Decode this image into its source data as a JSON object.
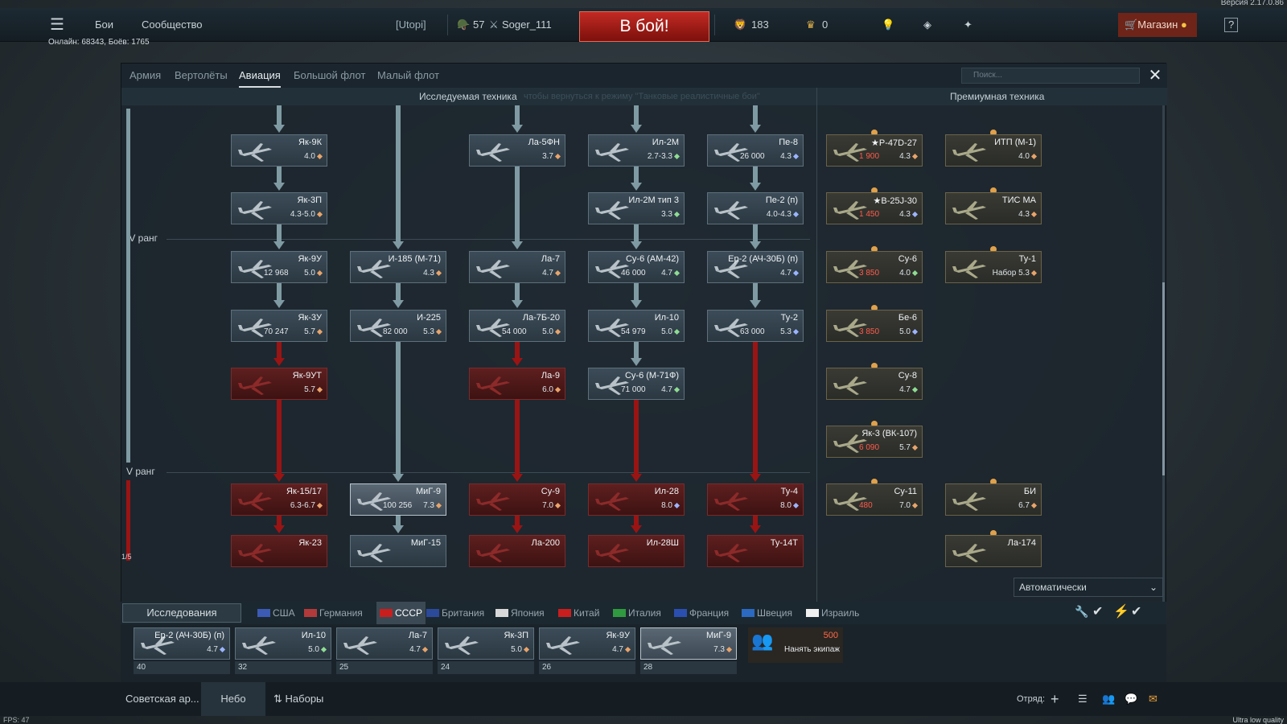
{
  "version": "Версия 2.17.0.86",
  "topbar": {
    "menu": "Бои",
    "community": "Сообщество",
    "squad_tag": "[Utopi]",
    "player_level": "57",
    "player_name": "Soger_111",
    "battle_button": "В бой!",
    "silver_lions": "183",
    "golden_eagles": "0",
    "shop": "Магазин",
    "help": "?"
  },
  "online": "Онлайн: 68343, Боёв: 1765",
  "tabs": [
    "Армия",
    "Вертолёты",
    "Авиация",
    "Большой флот",
    "Малый флот"
  ],
  "active_tab": "Авиация",
  "search_placeholder": "Поиск...",
  "headers": {
    "researched": "Исследуемая техника",
    "researched_hint": "чтобы вернуться к режиму \"Танковые реалистичные бои\"",
    "premium": "Премиумная техника"
  },
  "ranks": [
    "IV ранг",
    "V ранг"
  ],
  "page_indicator": "1/5",
  "tree": [
    {
      "id": "yak9k",
      "name": "Як-9К",
      "br": "4.0",
      "cost": "",
      "state": "researched",
      "dot": "orange"
    },
    {
      "id": "yak3p",
      "name": "Як-3П",
      "br": "4.3-5.0",
      "cost": "",
      "state": "researched",
      "dot": "orange"
    },
    {
      "id": "yak9u",
      "name": "Як-9У",
      "br": "5.0",
      "cost": "12 968",
      "state": "researched",
      "dot": "orange"
    },
    {
      "id": "yak3u",
      "name": "Як-3У",
      "br": "5.7",
      "cost": "70 247",
      "state": "researched",
      "dot": "orange"
    },
    {
      "id": "yak9ut",
      "name": "Як-9УТ",
      "br": "5.7",
      "cost": "",
      "state": "locked",
      "dot": "orange"
    },
    {
      "id": "yak1517",
      "name": "Як-15/17",
      "br": "6.3-6.7",
      "cost": "",
      "state": "locked",
      "dot": "orange"
    },
    {
      "id": "yak23",
      "name": "Як-23",
      "br": "",
      "cost": "",
      "state": "locked",
      "dot": ""
    },
    {
      "id": "i185",
      "name": "И-185 (М-71)",
      "br": "4.3",
      "cost": "",
      "state": "researched",
      "dot": "orange"
    },
    {
      "id": "i225",
      "name": "И-225",
      "br": "5.3",
      "cost": "82 000",
      "state": "researched",
      "dot": "orange"
    },
    {
      "id": "mig9",
      "name": "МиГ-9",
      "br": "7.3",
      "cost": "100 256",
      "state": "selected",
      "dot": "orange"
    },
    {
      "id": "mig15",
      "name": "МиГ-15",
      "br": "",
      "cost": "",
      "state": "researched",
      "dot": ""
    },
    {
      "id": "la5fn",
      "name": "Ла-5ФН",
      "br": "3.7",
      "cost": "",
      "state": "researched",
      "dot": "orange"
    },
    {
      "id": "la7",
      "name": "Ла-7",
      "br": "4.7",
      "cost": "",
      "state": "researched",
      "dot": "orange"
    },
    {
      "id": "la7b20",
      "name": "Ла-7Б-20",
      "br": "5.0",
      "cost": "54 000",
      "state": "researched",
      "dot": "orange"
    },
    {
      "id": "la9",
      "name": "Ла-9",
      "br": "6.0",
      "cost": "",
      "state": "locked",
      "dot": "orange"
    },
    {
      "id": "su9",
      "name": "Су-9",
      "br": "7.0",
      "cost": "",
      "state": "locked",
      "dot": "orange"
    },
    {
      "id": "la200",
      "name": "Ла-200",
      "br": "",
      "cost": "",
      "state": "locked",
      "dot": ""
    },
    {
      "id": "il2m",
      "name": "Ил-2М",
      "br": "2.7-3.3",
      "cost": "",
      "state": "researched",
      "dot": "green"
    },
    {
      "id": "il2m3",
      "name": "Ил-2М тип 3",
      "br": "3.3",
      "cost": "",
      "state": "researched",
      "dot": "green"
    },
    {
      "id": "su6am42",
      "name": "Су-6 (АМ-42)",
      "br": "4.7",
      "cost": "46 000",
      "state": "researched",
      "dot": "green"
    },
    {
      "id": "il10",
      "name": "Ил-10",
      "br": "5.0",
      "cost": "54 979",
      "state": "researched",
      "dot": "green"
    },
    {
      "id": "su6m71f",
      "name": "Су-6 (М-71Ф)",
      "br": "4.7",
      "cost": "71 000",
      "state": "researched",
      "dot": "green"
    },
    {
      "id": "il28",
      "name": "Ил-28",
      "br": "8.0",
      "cost": "",
      "state": "locked",
      "dot": "blue"
    },
    {
      "id": "il28sh",
      "name": "Ил-28Ш",
      "br": "",
      "cost": "",
      "state": "locked",
      "dot": ""
    },
    {
      "id": "pe8",
      "name": "Пе-8",
      "br": "4.3",
      "cost": "26 000",
      "state": "researched",
      "dot": "blue"
    },
    {
      "id": "pe2n",
      "name": "Пе-2 (п)",
      "br": "4.0-4.3",
      "cost": "",
      "state": "researched",
      "dot": "blue"
    },
    {
      "id": "er2",
      "name": "Ер-2 (АЧ-30Б) (п)",
      "br": "4.7",
      "cost": "",
      "state": "researched",
      "dot": "blue"
    },
    {
      "id": "tu2",
      "name": "Ту-2",
      "br": "5.3",
      "cost": "63 000",
      "state": "researched",
      "dot": "blue"
    },
    {
      "id": "tu4",
      "name": "Ту-4",
      "br": "8.0",
      "cost": "",
      "state": "locked",
      "dot": "blue"
    },
    {
      "id": "tu14t",
      "name": "Ту-14Т",
      "br": "",
      "cost": "",
      "state": "locked",
      "dot": ""
    }
  ],
  "premium": [
    {
      "id": "p47",
      "name": "★P-47D-27",
      "br": "4.3",
      "cost": "1 900",
      "dot": "orange"
    },
    {
      "id": "b25",
      "name": "★B-25J-30",
      "br": "4.3",
      "cost": "1 450",
      "dot": "blue"
    },
    {
      "id": "su6p",
      "name": "Су-6",
      "br": "4.0",
      "cost": "3 850",
      "dot": "green"
    },
    {
      "id": "be6",
      "name": "Бе-6",
      "br": "5.0",
      "cost": "3 850",
      "dot": "blue"
    },
    {
      "id": "su8",
      "name": "Су-8",
      "br": "4.7",
      "cost": "",
      "dot": "green"
    },
    {
      "id": "yak3vk",
      "name": "Як-3 (ВК-107)",
      "br": "5.7",
      "cost": "6 090",
      "dot": "orange"
    },
    {
      "id": "su11",
      "name": "Су-11",
      "br": "7.0",
      "cost": "480",
      "dot": "orange"
    },
    {
      "id": "itp",
      "name": "ИТП (М-1)",
      "br": "4.0",
      "cost": "",
      "dot": "orange"
    },
    {
      "id": "tisma",
      "name": "ТИС МА",
      "br": "4.3",
      "cost": "",
      "dot": "orange"
    },
    {
      "id": "tu1",
      "name": "Ту-1",
      "br": "Набор 5.3",
      "cost": "",
      "dot": "orange"
    },
    {
      "id": "bi",
      "name": "БИ",
      "br": "6.7",
      "cost": "",
      "dot": "orange"
    },
    {
      "id": "la174",
      "name": "Ла-174",
      "br": "",
      "cost": "",
      "dot": ""
    }
  ],
  "research_selector": "Исследования",
  "auto_selector": "Автоматически",
  "nations": [
    "США",
    "Германия",
    "СССР",
    "Британия",
    "Япония",
    "Китай",
    "Италия",
    "Франция",
    "Швеция",
    "Израиль"
  ],
  "active_nation": "СССР",
  "crew_slots": [
    {
      "name": "Ер-2 (АЧ-30Б) (п)",
      "br": "4.7",
      "crew": "40",
      "dot": "blue"
    },
    {
      "name": "Ил-10",
      "br": "5.0",
      "crew": "32",
      "dot": "green"
    },
    {
      "name": "Ла-7",
      "br": "4.7",
      "crew": "25",
      "dot": "orange"
    },
    {
      "name": "Як-3П",
      "br": "5.0",
      "crew": "24",
      "dot": "orange"
    },
    {
      "name": "Як-9У",
      "br": "4.7",
      "crew": "26",
      "dot": "orange"
    },
    {
      "name": "МиГ-9",
      "br": "7.3",
      "crew": "28",
      "dot": "orange"
    }
  ],
  "hire_crew": {
    "cost": "500",
    "label": "Нанять экипаж"
  },
  "bottom": {
    "preset": "Советская ар...",
    "sky": "Небо",
    "sets": "Наборы",
    "squad": "Отряд:"
  },
  "fps": "FPS: 47",
  "quality": "Ultra low quality",
  "colors": {
    "locked": "#9a1414",
    "researched_line": "#7f9aa3",
    "battle": "#c22a23"
  }
}
